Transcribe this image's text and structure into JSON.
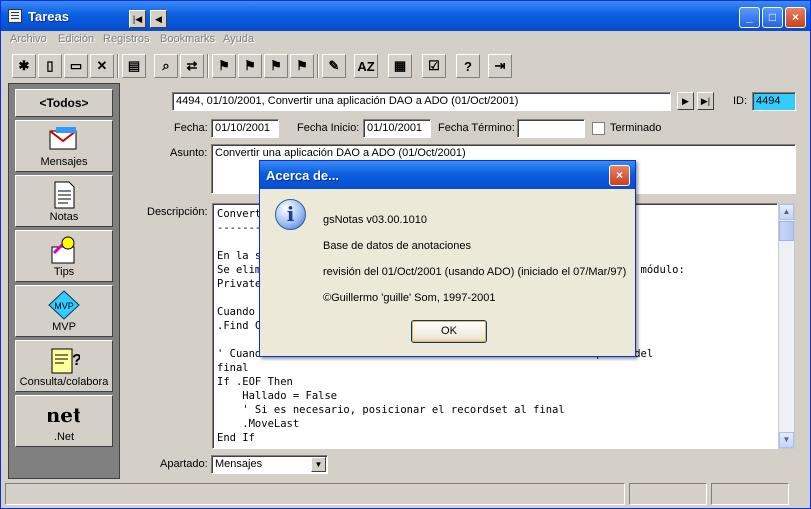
{
  "window": {
    "title": "Tareas"
  },
  "menu": [
    "Archivo",
    "Edición",
    "Registros",
    "Bookmarks",
    "Ayuda"
  ],
  "nav": {
    "record_text": "4494, 01/10/2001, Convertir una aplicación DAO a ADO (01/Oct/2001)",
    "id_label": "ID:",
    "id_value": "4494"
  },
  "form": {
    "fecha_label": "Fecha:",
    "fecha_value": "01/10/2001",
    "fecha_inicio_label": "Fecha Inicio:",
    "fecha_inicio_value": "01/10/2001",
    "fecha_termino_label": "Fecha Término:",
    "fecha_termino_value": "",
    "terminado_label": "Terminado",
    "asunto_label": "Asunto:",
    "asunto_value": "Convertir una aplicación DAO a ADO (01/Oct/2001)",
    "descripcion_label": "Descripción:",
    "apartado_label": "Apartado:",
    "apartado_value": "Mensajes"
  },
  "sidebar": {
    "todos": "<Todos>",
    "items": [
      {
        "label": "Mensajes",
        "icon": "messages-icon"
      },
      {
        "label": "Notas",
        "icon": "notes-icon"
      },
      {
        "label": "Tips",
        "icon": "tips-icon"
      },
      {
        "label": "MVP",
        "icon": "mvp-icon"
      },
      {
        "label": "Consulta/colabora",
        "icon": "consult-icon"
      },
      {
        "label": ".Net",
        "icon": "net-icon"
      }
    ]
  },
  "code": {
    "lines": [
      "Convert",
      "-------",
      "",
      "En la s",
      "Se elim                                                      el de módulo:",
      "Private",
      "",
      "Cuando                                                       o:",
      ".Find C",
      "",
      "' Cuand                                             ará \"después\" del",
      "final",
      "If .EOF Then",
      "    Hallado = False",
      "    ' Si es necesario, posicionar el recordset al final",
      "    .MoveLast",
      "End If"
    ]
  },
  "dialog": {
    "title": "Acerca de...",
    "app": "gsNotas v03.00.1010",
    "desc": "Base de datos de anotaciones",
    "revision": "revisión del 01/Oct/2001 (usando ADO) (iniciado el 07/Mar/97)",
    "copyright": "©Guillermo 'guille' Som, 1997-2001",
    "ok": "OK"
  }
}
